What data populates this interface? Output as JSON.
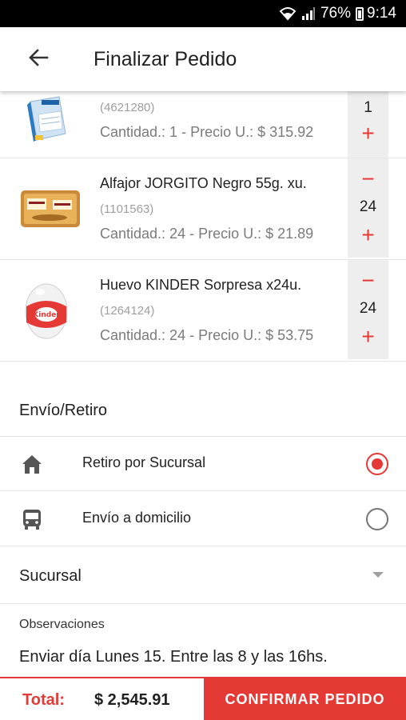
{
  "status_bar": {
    "battery": "76%",
    "time": "9:14"
  },
  "app_bar": {
    "title": "Finalizar Pedido"
  },
  "cart_items": [
    {
      "name": "",
      "code": "(4621280)",
      "detail": "Cantidad.: 1 - Precio U.: $ 315.92",
      "quantity": "1"
    },
    {
      "name": "Alfajor JORGITO Negro 55g. xu.",
      "code": "(1101563)",
      "detail": "Cantidad.: 24 - Precio U.: $ 21.89",
      "quantity": "24"
    },
    {
      "name": "Huevo KINDER Sorpresa x24u.",
      "code": "(1264124)",
      "detail": "Cantidad.: 24 - Precio U.: $ 53.75",
      "quantity": "24"
    }
  ],
  "stepper": {
    "minus": "−",
    "plus": "+"
  },
  "delivery": {
    "section_title": "Envío/Retiro",
    "options": [
      {
        "label": "Retiro por Sucursal",
        "icon": "home-icon",
        "selected": true
      },
      {
        "label": "Envío a domicilio",
        "icon": "bus-icon",
        "selected": false
      }
    ]
  },
  "branch_select": {
    "value": "Sucursal"
  },
  "observations": {
    "label": "Observaciones",
    "value": "Enviar día Lunes 15. Entre las 8 y las 16hs."
  },
  "footer": {
    "total_label": "Total:",
    "total_value": "$ 2,545.91",
    "confirm_label": "CONFIRMAR PEDIDO"
  },
  "colors": {
    "accent": "#e53935",
    "stepper_bg": "#eeeeee"
  }
}
